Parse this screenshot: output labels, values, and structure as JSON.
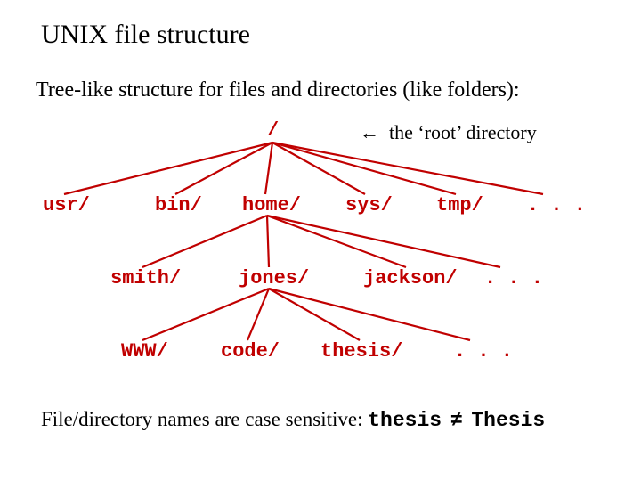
{
  "title": "UNIX file structure",
  "subtitle": "Tree-like structure for files and directories (like folders):",
  "annotation": {
    "arrow": "←",
    "text": "the ‘root’ directory"
  },
  "nodes": {
    "root": "/",
    "level1": {
      "usr": "usr/",
      "bin": "bin/",
      "home": "home/",
      "sys": "sys/",
      "tmp": "tmp/",
      "ell": ". . ."
    },
    "level2": {
      "smith": "smith/",
      "jones": "jones/",
      "jackson": "jackson/",
      "ell": ". . ."
    },
    "level3": {
      "www": "WWW/",
      "code": "code/",
      "thesis": "thesis/",
      "ell": ". . ."
    }
  },
  "footer": {
    "lead": "File/directory names are case sensitive: ",
    "ex_a": "thesis",
    "neq": "≠",
    "ex_b": "Thesis"
  }
}
